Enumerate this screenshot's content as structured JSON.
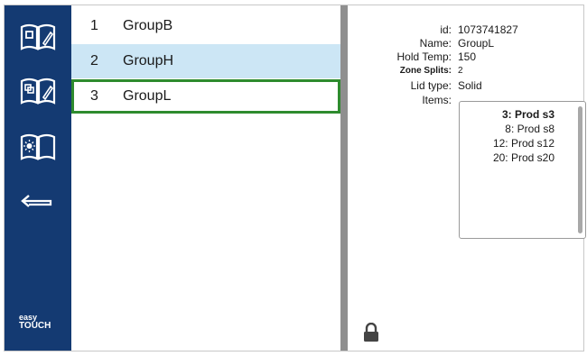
{
  "sidebar": {
    "buttons": [
      {
        "name": "book-edit-icon"
      },
      {
        "name": "book-copy-icon"
      },
      {
        "name": "day-night-icon"
      },
      {
        "name": "back-arrow-icon"
      }
    ],
    "brand_line1": "easy",
    "brand_line2": "TOUCH"
  },
  "groups": [
    {
      "num": "1",
      "name": "GroupB"
    },
    {
      "num": "2",
      "name": "GroupH"
    },
    {
      "num": "3",
      "name": "GroupL"
    }
  ],
  "details": {
    "id_label": "id:",
    "id_value": "1073741827",
    "name_label": "Name:",
    "name_value": "GroupL",
    "hold_temp_label": "Hold Temp:",
    "hold_temp_value": "150",
    "zone_splits_label": "Zone Splits:",
    "zone_splits_value": "2",
    "lid_type_label": "Lid type:",
    "lid_type_value": "Solid",
    "items_label": "Items:",
    "items": [
      "3: Prod s3",
      "8: Prod s8",
      "12: Prod s12",
      "20: Prod s20"
    ]
  },
  "colors": {
    "sidebar": "#143a72",
    "selected_row": "#cce6f5",
    "active_border": "#2e8b2e",
    "divider": "#8f8f8f"
  },
  "lock_icon": "lock-icon"
}
